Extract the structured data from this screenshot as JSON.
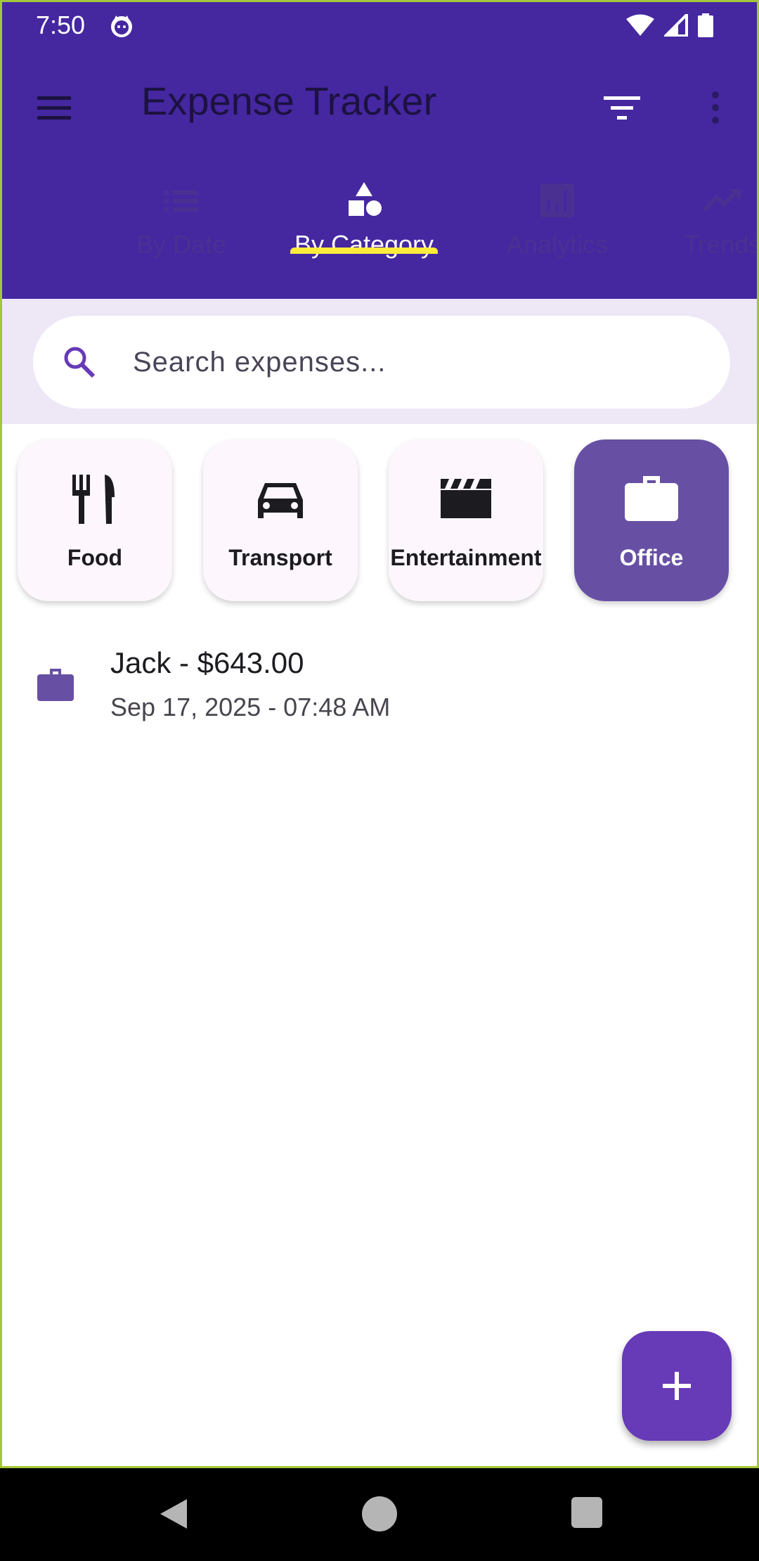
{
  "status_bar": {
    "time": "7:50"
  },
  "app_bar": {
    "title": "Expense Tracker"
  },
  "tabs": [
    {
      "label": "By Date",
      "icon": "list-icon",
      "active": false
    },
    {
      "label": "By Category",
      "icon": "category-shapes-icon",
      "active": true
    },
    {
      "label": "Analytics",
      "icon": "analytics-icon",
      "active": false
    },
    {
      "label": "Trends",
      "icon": "trending-up-icon",
      "active": false
    }
  ],
  "search": {
    "placeholder": "Search expenses...",
    "value": ""
  },
  "categories": [
    {
      "label": "Food",
      "icon": "restaurant-icon",
      "selected": false
    },
    {
      "label": "Transport",
      "icon": "car-icon",
      "selected": false
    },
    {
      "label": "Entertainment",
      "icon": "movie-clapper-icon",
      "selected": false
    },
    {
      "label": "Office",
      "icon": "briefcase-icon",
      "selected": true
    }
  ],
  "expenses": [
    {
      "title": "Jack - $643.00",
      "subtitle": "Sep 17, 2025 - 07:48 AM",
      "icon": "briefcase-icon"
    }
  ],
  "colors": {
    "primary": "#4527a0",
    "accent_indicator": "#ffeb3b",
    "selected_card": "#6750a4",
    "fab": "#673ab7",
    "search_bg": "#ede7f6"
  }
}
